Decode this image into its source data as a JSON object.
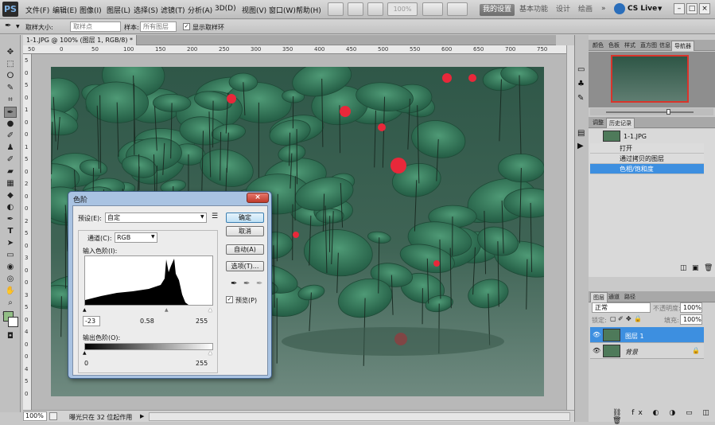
{
  "app": {
    "logo": "PS",
    "menus": [
      "文件(F)",
      "编辑(E)",
      "图像(I)",
      "图层(L)",
      "选择(S)",
      "滤镜(T)",
      "分析(A)",
      "3D(D)",
      "视图(V)",
      "窗口(W)",
      "帮助(H)"
    ],
    "zoom_display": "100%",
    "workspaces": [
      "我的设置",
      "基本功能",
      "设计",
      "绘画"
    ],
    "active_workspace": "我的设置",
    "cs_live": "CS Live",
    "window_buttons": [
      "–",
      "□",
      "×"
    ],
    "colors": {
      "accent": "#3d8fe0",
      "flower": "#e8283a"
    }
  },
  "options_bar": {
    "sample_size_label": "取样大小:",
    "sample_size_value": "取样点",
    "sample_label": "样本:",
    "sample_value": "所有图层",
    "show_ring_label": "显示取样环",
    "show_ring_checked": true
  },
  "document": {
    "tab_title": "1-1.JPG @ 100% (图层 1, RGB/8) *",
    "ruler_top": [
      "50",
      "0",
      "50",
      "100",
      "150",
      "200",
      "250",
      "300",
      "350",
      "400",
      "450",
      "500",
      "550",
      "600",
      "650",
      "700",
      "750"
    ],
    "ruler_left": [
      "5",
      "0",
      "5",
      "0",
      "1",
      "0",
      "0",
      "1",
      "5",
      "0",
      "2",
      "0",
      "0",
      "2",
      "5",
      "0",
      "3",
      "0",
      "0",
      "3",
      "5",
      "0",
      "4",
      "0",
      "0",
      "4",
      "5",
      "0"
    ],
    "status_zoom": "100%",
    "status_text": "曝光只在 32 位起作用"
  },
  "panels": {
    "navigator_tabs": [
      "颜色",
      "色板",
      "样式",
      "直方图",
      "信息",
      "导航器"
    ],
    "navigator_active": "导航器",
    "history_tabs": [
      "调整",
      "历史记录"
    ],
    "history_active": "历史记录",
    "history_snapshot": "1-1.JPG",
    "history_items": [
      "打开",
      "通过拷贝的图层",
      "色相/饱和度"
    ],
    "history_selected": 2,
    "layers_tabs": [
      "图层",
      "通道",
      "路径"
    ],
    "layers_active": "图层",
    "blend_mode": "正常",
    "opacity_label": "不透明度:",
    "opacity_value": "100%",
    "lock_label": "锁定:",
    "fill_label": "填充:",
    "fill_value": "100%",
    "layers": [
      "图层 1",
      "背景"
    ],
    "layer_selected": 0
  },
  "levels_dialog": {
    "title": "色阶",
    "close": "×",
    "preset_label": "预设(E):",
    "preset_value": "自定",
    "channel_label": "通道(C):",
    "channel_value": "RGB",
    "input_label": "输入色阶(I):",
    "input_values": [
      "-23",
      "0.58",
      "255"
    ],
    "output_label": "输出色阶(O):",
    "output_values": [
      "0",
      "255"
    ],
    "buttons": {
      "ok": "确定",
      "reset": "取消",
      "auto": "自动(A)",
      "options": "选项(T)..."
    },
    "preview_label": "预览(P)",
    "preview_checked": true
  }
}
